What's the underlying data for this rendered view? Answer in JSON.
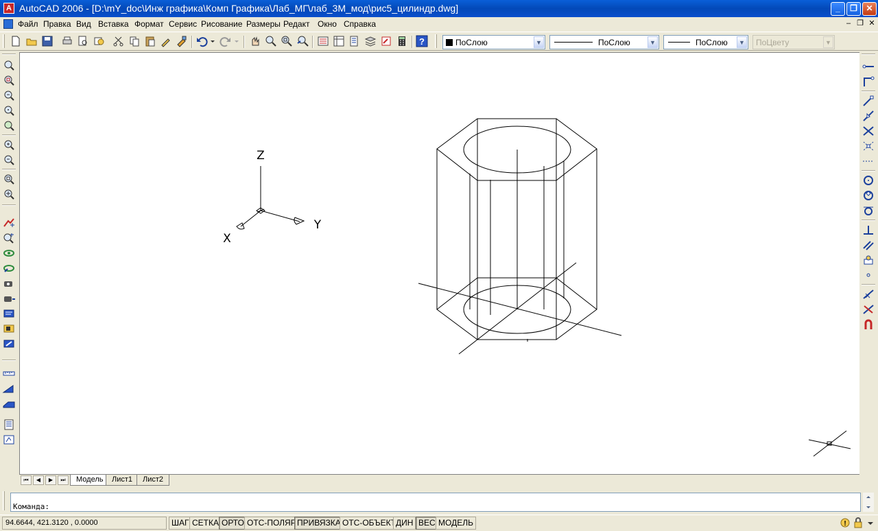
{
  "window": {
    "title": "AutoCAD 2006 - [D:\\mY_doc\\Инж графика\\Комп Графика\\Лаб_МГ\\лаб_3М_мод\\рис5_цилиндр.dwg]",
    "app_icon_glyph": "A",
    "minimize_glyph": "_",
    "maximize_glyph": "❐",
    "close_glyph": "✕"
  },
  "menu": {
    "items": [
      "Файл",
      "Правка",
      "Вид",
      "Вставка",
      "Формат",
      "Сервис",
      "Рисование",
      "Размеры",
      "Редакт",
      "Окно",
      "Справка"
    ],
    "doc_minimize": "–",
    "doc_restore": "❐",
    "doc_close": "✕"
  },
  "toolbar": {
    "color_combo": "ПоСлою",
    "linetype_combo": "ПоСлою",
    "lineweight_combo": "ПоСлою",
    "plotstyle_combo": "ПоЦвету",
    "combo_arrow": "▼",
    "icons": [
      "new-icon",
      "open-icon",
      "save-icon",
      "print-icon",
      "preview-icon",
      "publish-icon",
      "cut-icon",
      "copy-icon",
      "paste-icon",
      "matchprop-icon",
      "blockeditor-icon",
      "undo-icon",
      "redo-icon",
      "pan-icon",
      "zoom-realtime-icon",
      "zoom-window-icon",
      "zoom-previous-icon",
      "properties-icon",
      "designcenter-icon",
      "toolpalettes-icon",
      "sheetset-icon",
      "markup-icon",
      "calculator-icon",
      "help-icon"
    ]
  },
  "ucs": {
    "x": "X",
    "y": "Y",
    "z": "Z"
  },
  "tabs": {
    "nav": [
      "⏮",
      "◀",
      "▶",
      "⏭"
    ],
    "items": [
      "Модель",
      "Лист1",
      "Лист2"
    ],
    "active": "Модель"
  },
  "command": {
    "prompt": "Команда:"
  },
  "status": {
    "coordinates": "94.6644,  421.3120 , 0.0000",
    "buttons": [
      {
        "label": "ШАГ",
        "on": false
      },
      {
        "label": "СЕТКА",
        "on": false
      },
      {
        "label": "ОРТО",
        "on": true
      },
      {
        "label": "ОТС-ПОЛЯР",
        "on": false
      },
      {
        "label": "ПРИВЯЗКА",
        "on": true
      },
      {
        "label": "ОТС-ОБЪЕКТ",
        "on": false
      },
      {
        "label": "ДИН",
        "on": false
      },
      {
        "label": "ВЕС",
        "on": true
      },
      {
        "label": "МОДЕЛЬ",
        "on": false
      }
    ]
  },
  "colors": {
    "titlebar": "#0A5FD8",
    "ui_face": "#ECE9D8",
    "canvas": "#FFFFFF",
    "geometry": "#000000"
  }
}
